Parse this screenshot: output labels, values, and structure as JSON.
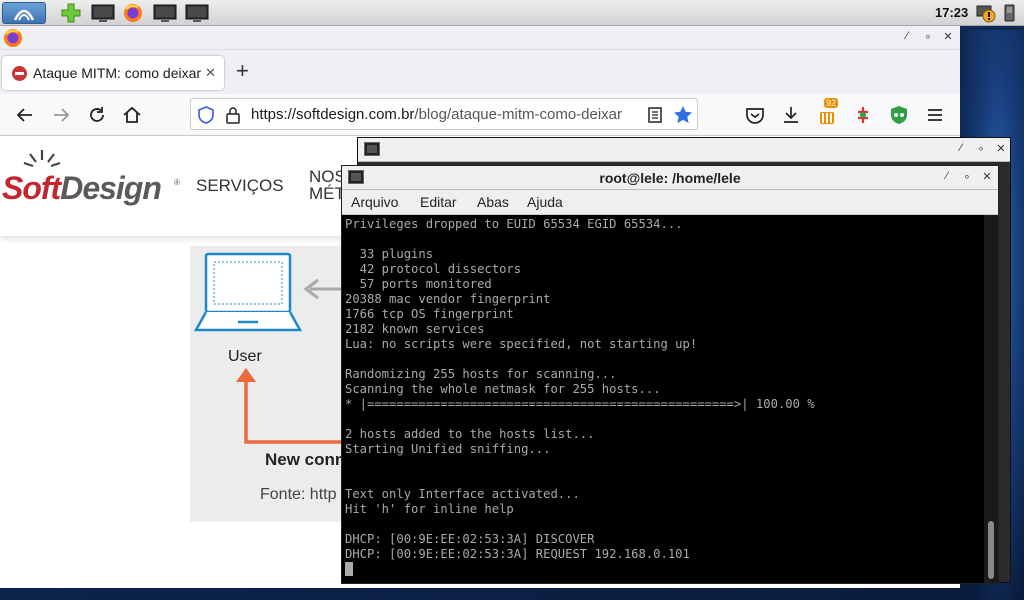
{
  "panel": {
    "clock": "17:23",
    "launchers": [
      "app-menu-icon",
      "add-applet-icon",
      "terminal-icon",
      "firefox-icon",
      "terminal-icon",
      "terminal-icon"
    ]
  },
  "browser": {
    "tab_title": "Ataque MITM: como deixar",
    "tab_close": "✕",
    "new_tab": "+",
    "url_domain": "https://softdesign.com.br",
    "url_path": "/blog/ataque-mitm-como-deixar",
    "badge_count": "92",
    "window_controls": [
      "⁄",
      "∘",
      "✕"
    ]
  },
  "site": {
    "logo_soft": "Soft",
    "logo_design": "Design",
    "logo_reg": "®",
    "menu": [
      "SERVIÇOS",
      "NOS",
      "MÉT"
    ],
    "diagram_user": "User",
    "diagram_newconn": "New conn",
    "diagram_fonte": "Fonte: http"
  },
  "terminal": {
    "title": "root@lele: /home/lele",
    "menu": [
      "Arquivo",
      "Editar",
      "Abas",
      "Ajuda"
    ],
    "lines": [
      "Privileges dropped to EUID 65534 EGID 65534...",
      "",
      "  33 plugins",
      "  42 protocol dissectors",
      "  57 ports monitored",
      "20388 mac vendor fingerprint",
      "1766 tcp OS fingerprint",
      "2182 known services",
      "Lua: no scripts were specified, not starting up!",
      "",
      "Randomizing 255 hosts for scanning...",
      "Scanning the whole netmask for 255 hosts...",
      "* |==================================================>| 100.00 %",
      "",
      "2 hosts added to the hosts list...",
      "Starting Unified sniffing...",
      "",
      "",
      "Text only Interface activated...",
      "Hit 'h' for inline help",
      "",
      "DHCP: [00:9E:EE:02:53:3A] DISCOVER",
      "DHCP: [00:9E:EE:02:53:3A] REQUEST 192.168.0.101"
    ]
  }
}
